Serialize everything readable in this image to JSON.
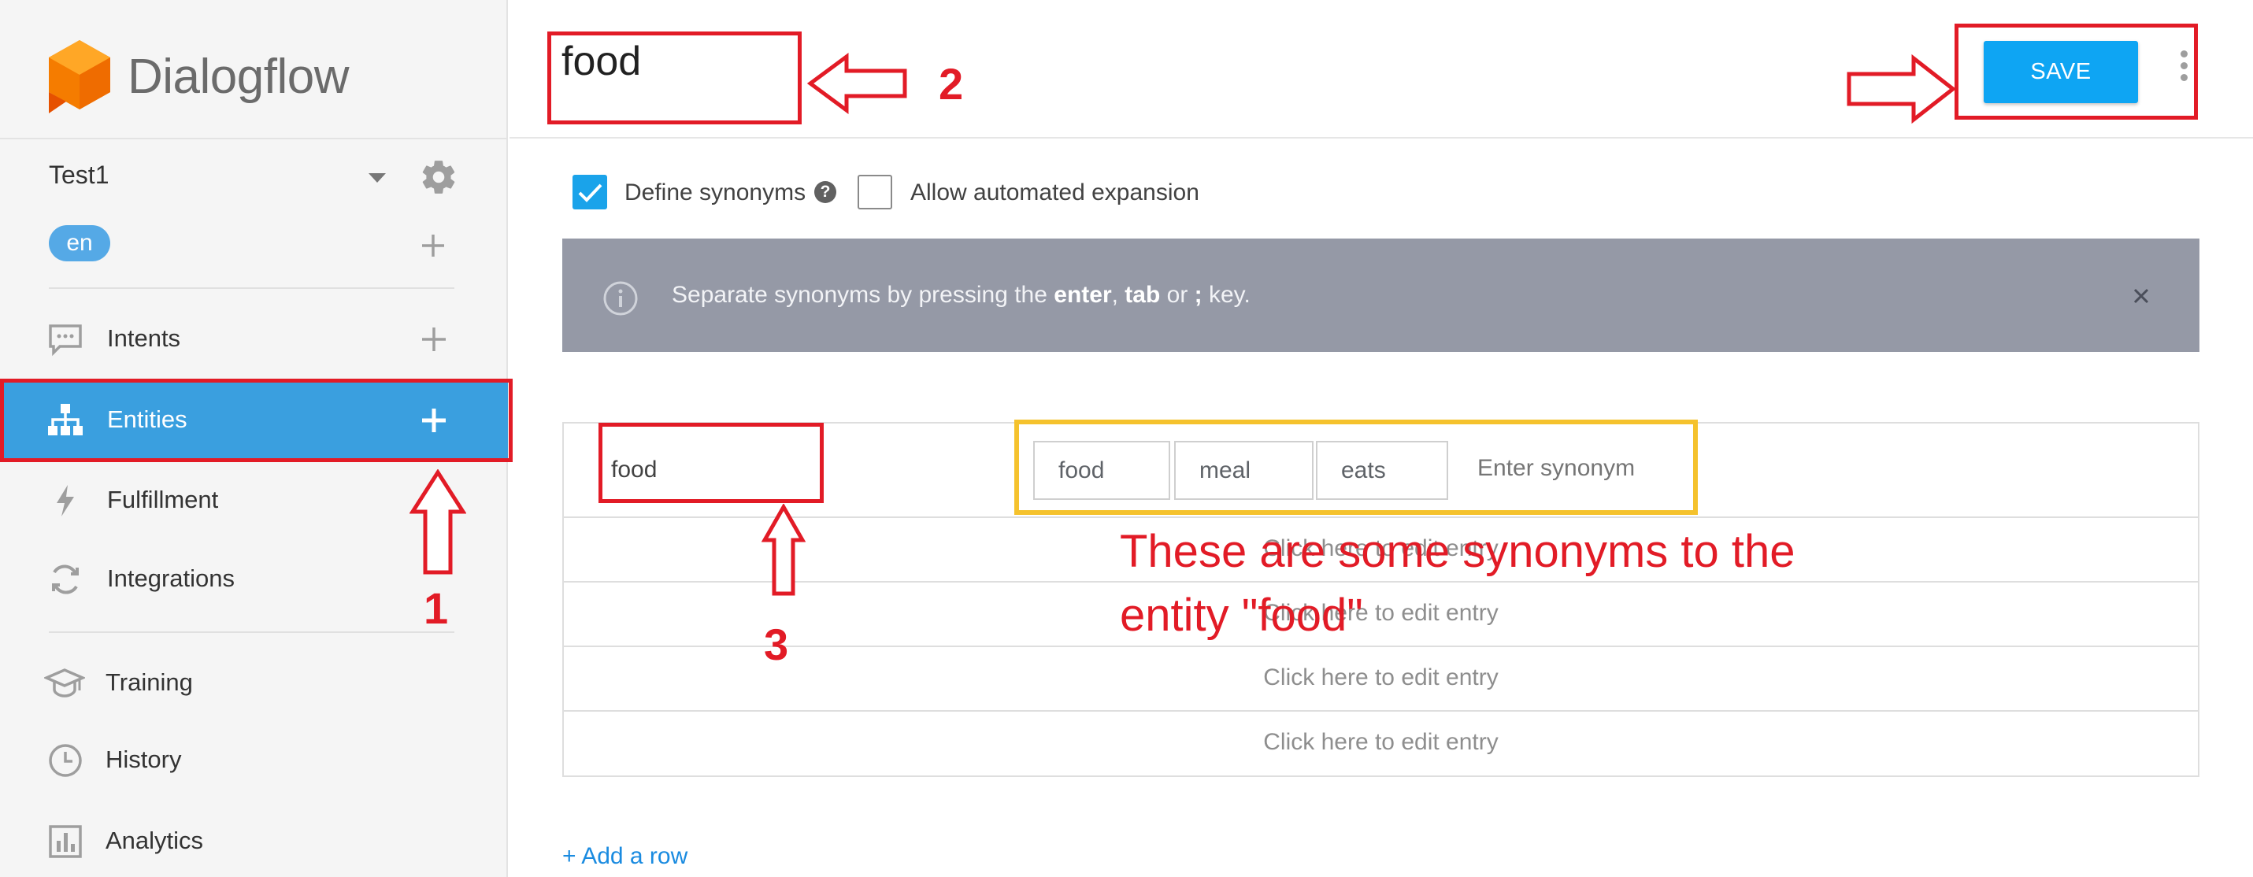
{
  "app": {
    "logo_text": "Dialogflow"
  },
  "sidebar": {
    "agent_name": "Test1",
    "language": "en",
    "items": [
      {
        "label": "Intents",
        "icon": "chat-bubble-icon",
        "active": false
      },
      {
        "label": "Entities",
        "icon": "sitemap-icon",
        "active": true
      },
      {
        "label": "Fulfillment",
        "icon": "lightning-icon",
        "active": false
      },
      {
        "label": "Integrations",
        "icon": "sync-icon",
        "active": false
      },
      {
        "label": "Training",
        "icon": "graduation-cap-icon",
        "active": false
      },
      {
        "label": "History",
        "icon": "clock-icon",
        "active": false
      },
      {
        "label": "Analytics",
        "icon": "bar-chart-icon",
        "active": false
      }
    ]
  },
  "header": {
    "entity_name": "food",
    "save_label": "SAVE"
  },
  "options": {
    "define_synonyms_label": "Define synonyms",
    "define_synonyms_checked": true,
    "help_glyph": "?",
    "auto_expansion_label": "Allow automated expansion",
    "auto_expansion_checked": false
  },
  "info_banner": {
    "text_before": "Separate synonyms by pressing the ",
    "key_enter": "enter",
    "sep_comma": ", ",
    "key_tab": "tab",
    "sep_or": " or ",
    "key_semicolon": ";",
    "text_after": " key."
  },
  "entries": {
    "rows": [
      {
        "value": "food",
        "synonyms": [
          "food",
          "meal",
          "eats"
        ],
        "synonym_placeholder": "Enter synonym"
      }
    ],
    "empty_row_label": "Click here to edit entry",
    "add_row_label": "+ Add a row"
  },
  "annotations": {
    "step_1": "1",
    "step_2": "2",
    "step_3": "3",
    "note": "These are some synonyms to the entity \"food\""
  },
  "colors": {
    "accent": "#3a9fdf",
    "save_button": "#0ea5f3",
    "banner": "#9599a6",
    "annotation_red": "#e21b26",
    "annotation_yellow": "#f5c22d"
  }
}
